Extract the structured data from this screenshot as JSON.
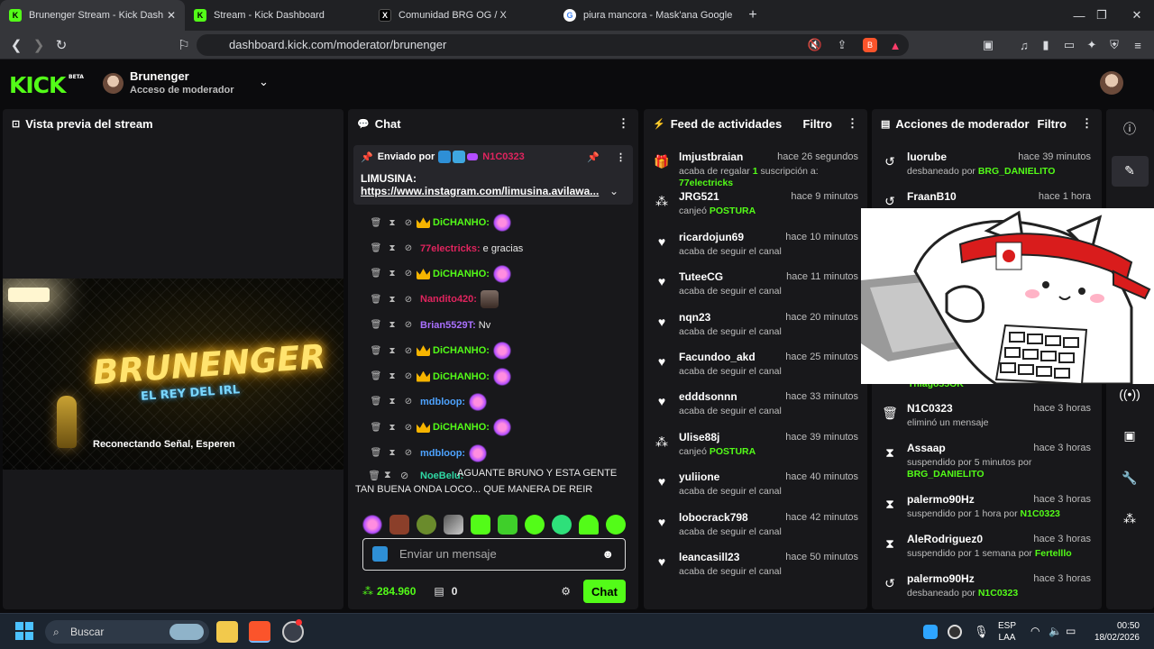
{
  "browser": {
    "tabs": [
      {
        "title": "Brunenger Stream - Kick Dash",
        "icon": "kick-icon",
        "active": true
      },
      {
        "title": "Stream - Kick Dashboard",
        "icon": "kick-icon",
        "active": false
      },
      {
        "title": "Comunidad BRG OG / X",
        "icon": "x-icon",
        "active": false
      },
      {
        "title": "piura mancora - Mask'ana Google",
        "icon": "google-icon",
        "active": false
      }
    ],
    "url": "dashboard.kick.com/moderator/brunenger"
  },
  "header": {
    "logo": "KICK",
    "logo_badge": "BETA",
    "channel_name": "Brunenger",
    "channel_role": "Acceso de moderador"
  },
  "preview": {
    "title": "Vista previa del stream",
    "art_title": "BRUNENGER",
    "art_subtitle": "EL REY DEL IRL",
    "status_text": "Reconectando Señal, Esperen"
  },
  "chat": {
    "title": "Chat",
    "pinned_label": "Enviado por",
    "pinned_user": "N1C0323",
    "pinned_text": "LIMUSINA:",
    "pinned_link": "https://www.instagram.com/limusina.avilawa...",
    "messages": [
      {
        "user": "DiCHANHO:",
        "color": "#53fc18",
        "text": "",
        "crown": true,
        "emote": "pink"
      },
      {
        "user": "77electricks:",
        "color": "#e0245e",
        "text": "e gracias",
        "crown": false,
        "emote": ""
      },
      {
        "user": "DiCHANHO:",
        "color": "#53fc18",
        "text": "",
        "crown": true,
        "emote": "pink"
      },
      {
        "user": "Nandito420:",
        "color": "#e0245e",
        "text": "",
        "crown": false,
        "emote": "face"
      },
      {
        "user": "Brian5529T:",
        "color": "#a970ff",
        "text": "Nv",
        "crown": false,
        "emote": ""
      },
      {
        "user": "DiCHANHO:",
        "color": "#53fc18",
        "text": "",
        "crown": true,
        "emote": "pink"
      },
      {
        "user": "DiCHANHO:",
        "color": "#53fc18",
        "text": "",
        "crown": true,
        "emote": "pink"
      },
      {
        "user": "mdbloop:",
        "color": "#4ea3ff",
        "text": "",
        "crown": false,
        "emote": "pink"
      },
      {
        "user": "DiCHANHO:",
        "color": "#53fc18",
        "text": "",
        "crown": true,
        "emote": "pink"
      },
      {
        "user": "mdbloop:",
        "color": "#4ea3ff",
        "text": "",
        "crown": false,
        "emote": "pink"
      }
    ],
    "last_message_user": "NoeBelu:",
    "last_message_text": "AGUANTE BRUNO Y ESTA GENTE TAN BUENA ONDA LOCO... QUE MANERA DE REIR",
    "input_placeholder": "Enviar un mensaje",
    "points": "284.960",
    "store_count": "0",
    "send_label": "Chat"
  },
  "feed": {
    "title": "Feed de actividades",
    "filter_label": "Filtro",
    "items": [
      {
        "icon": "gift-icon",
        "name": "lmjustbraian",
        "time": "hace 26 segundos",
        "pre": "acaba de regalar ",
        "hl": "1",
        "post": " suscripción a: ",
        "hl2": "77electricks"
      },
      {
        "icon": "points-icon",
        "name": "JRG521",
        "time": "hace 9 minutos",
        "pre": "canjeó ",
        "hl": "POSTURA",
        "post": "",
        "hl2": ""
      },
      {
        "icon": "heart-icon",
        "name": "ricardojun69",
        "time": "hace 10 minutos",
        "pre": "acaba de seguir el canal",
        "hl": "",
        "post": "",
        "hl2": ""
      },
      {
        "icon": "heart-icon",
        "name": "TuteeCG",
        "time": "hace 11 minutos",
        "pre": "acaba de seguir el canal",
        "hl": "",
        "post": "",
        "hl2": ""
      },
      {
        "icon": "heart-icon",
        "name": "nqn23",
        "time": "hace 20 minutos",
        "pre": "acaba de seguir el canal",
        "hl": "",
        "post": "",
        "hl2": ""
      },
      {
        "icon": "heart-icon",
        "name": "Facundoo_akd",
        "time": "hace 25 minutos",
        "pre": "acaba de seguir el canal",
        "hl": "",
        "post": "",
        "hl2": ""
      },
      {
        "icon": "heart-icon",
        "name": "edddsonnn",
        "time": "hace 33 minutos",
        "pre": "acaba de seguir el canal",
        "hl": "",
        "post": "",
        "hl2": ""
      },
      {
        "icon": "points-icon",
        "name": "Ulise88j",
        "time": "hace 39 minutos",
        "pre": "canjeó ",
        "hl": "POSTURA",
        "post": "",
        "hl2": ""
      },
      {
        "icon": "heart-icon",
        "name": "yuliione",
        "time": "hace 40 minutos",
        "pre": "acaba de seguir el canal",
        "hl": "",
        "post": "",
        "hl2": ""
      },
      {
        "icon": "heart-icon",
        "name": "lobocrack798",
        "time": "hace 42 minutos",
        "pre": "acaba de seguir el canal",
        "hl": "",
        "post": "",
        "hl2": ""
      },
      {
        "icon": "heart-icon",
        "name": "leancasill23",
        "time": "hace 50 minutos",
        "pre": "acaba de seguir el canal",
        "hl": "",
        "post": "",
        "hl2": ""
      }
    ]
  },
  "modactions": {
    "title": "Acciones de moderador",
    "filter_label": "Filtro",
    "items": [
      {
        "icon": "unban-icon",
        "name": "luorube",
        "time": "hace 39 minutos",
        "pre": "desbaneado por ",
        "hl": "BRG_DANIELITO"
      },
      {
        "icon": "unban-icon",
        "name": "FraanB10",
        "time": "hace 1 hora",
        "pre": "",
        "hl": ""
      },
      {
        "icon": "trash-icon",
        "name": "N1C0323",
        "time": "hace 3 horas",
        "pre": "eliminó un mensaje",
        "hl": ""
      },
      {
        "icon": "hourglass-icon",
        "name": "Assaap",
        "time": "hace 3 horas",
        "pre": "suspendido por 5 minutos por ",
        "hl": "BRG_DANIELITO"
      },
      {
        "icon": "hourglass-icon",
        "name": "palermo90Hz",
        "time": "hace 3 horas",
        "pre": "suspendido por 1 hora por ",
        "hl": "N1C0323"
      },
      {
        "icon": "hourglass-icon",
        "name": "AleRodriguez0",
        "time": "hace 3 horas",
        "pre": "suspendido por 1 semana por ",
        "hl": "Fertelllo"
      },
      {
        "icon": "unban-icon",
        "name": "palermo90Hz",
        "time": "hace 3 horas",
        "pre": "desbaneado por ",
        "hl": "N1C0323"
      }
    ],
    "partial_name": "Thiago55OK"
  },
  "taskbar": {
    "search_placeholder": "Buscar",
    "lang": "ESP",
    "layout": "LAA",
    "time": "00:50",
    "date": "18/02/2026"
  }
}
